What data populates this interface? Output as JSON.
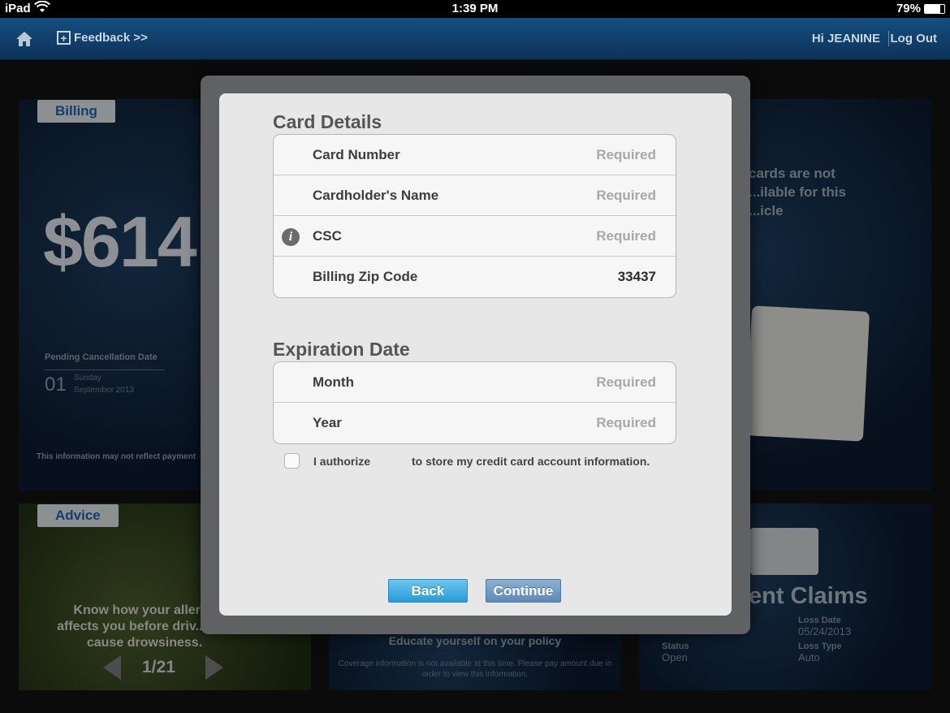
{
  "status_bar": {
    "device": "iPad",
    "time": "1:39 PM",
    "battery": "79%"
  },
  "nav": {
    "feedback_label": "Feedback >>",
    "greeting": "Hi JEANINE",
    "logout_label": "Log Out"
  },
  "background": {
    "billing": {
      "tag": "Billing",
      "amount": "$614",
      "pending_label": "Pending Cancellation Date",
      "day": "01",
      "weekday": "Sunday",
      "month_year": "September 2013",
      "disclaimer": "This information may not reflect payment"
    },
    "advice": {
      "tag": "Advice",
      "text": "Know how your allergy affects you before driv... can cause drowsiness.",
      "page": "1/21"
    },
    "id_cards": {
      "text": "cards are not ...ilable for this ...icle"
    },
    "policy": {
      "title": "Educate yourself on your policy",
      "note": "Coverage information is not available at this time. Please pay amount due in order to view this information."
    },
    "claims": {
      "title": "ent Claims",
      "loss_date_label": "Loss Date",
      "loss_date": "05/24/2013",
      "status_label": "Status",
      "status": "Open",
      "loss_type_label": "Loss Type",
      "loss_type": "Auto"
    }
  },
  "modal": {
    "card_details_title": "Card Details",
    "card_rows": [
      {
        "label": "Card Number",
        "value": "Required"
      },
      {
        "label": "Cardholder's Name",
        "value": "Required"
      },
      {
        "label": "CSC",
        "value": "Required"
      },
      {
        "label": "Billing Zip Code",
        "value": "33437"
      }
    ],
    "expiration_title": "Expiration Date",
    "exp_rows": [
      {
        "label": "Month",
        "value": "Required"
      },
      {
        "label": "Year",
        "value": "Required"
      }
    ],
    "authorize_part1": "I authorize",
    "authorize_part2": "to store my credit card account information.",
    "back_label": "Back",
    "continue_label": "Continue"
  }
}
